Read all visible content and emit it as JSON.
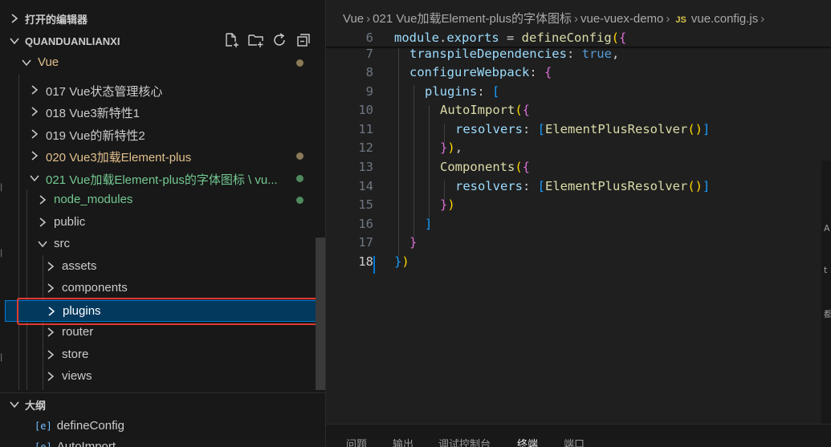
{
  "sidebar": {
    "open_editors_title": "打开的编辑器",
    "project_title": "QUANDUANLIANXI",
    "toolbar": [
      "new-file-icon",
      "new-folder-icon",
      "refresh-icon",
      "collapse-all-icon"
    ],
    "tree": [
      {
        "label": "Vue",
        "color": "#e2c08d",
        "dot": "#8a7a57"
      },
      {
        "label": "017 Vue状态管理核心",
        "color": "#cccccc"
      },
      {
        "label": "018 Vue3新特性1",
        "color": "#cccccc"
      },
      {
        "label": "019 Vue的新特性2",
        "color": "#cccccc"
      },
      {
        "label": "020 Vue3加载Element-plus",
        "color": "#e2c08d",
        "dot": "#8a7a57"
      },
      {
        "label": "021 Vue加载Element-plus的字体图标 \\ vu...",
        "color": "#73c991",
        "dot": "#4f8a5f"
      },
      {
        "label": "node_modules",
        "color": "#73c991",
        "dot": "#4f8a5f"
      },
      {
        "label": "public",
        "color": "#cccccc"
      },
      {
        "label": "src",
        "color": "#cccccc"
      },
      {
        "label": "assets",
        "color": "#cccccc"
      },
      {
        "label": "components",
        "color": "#cccccc"
      },
      {
        "label": "plugins",
        "color": "#ffffff"
      },
      {
        "label": "router",
        "color": "#cccccc"
      },
      {
        "label": "store",
        "color": "#cccccc"
      },
      {
        "label": "views",
        "color": "#cccccc"
      }
    ],
    "outline_title": "大纲",
    "outline_items": [
      {
        "label": "defineConfig",
        "icon": "[e]"
      },
      {
        "label": "AutoImport",
        "icon": "[e]"
      }
    ]
  },
  "breadcrumb": [
    "Vue",
    "021 Vue加载Element-plus的字体图标",
    "vue-vuex-demo",
    "vue.config.js"
  ],
  "breadcrumb_badge": "JS",
  "code": {
    "line_numbers": [
      "6",
      "7",
      "8",
      "9",
      "10",
      "11",
      "12",
      "13",
      "14",
      "15",
      "16",
      "17",
      "18"
    ],
    "active_line": "18"
  },
  "panel_tabs": [
    "问题",
    "输出",
    "调试控制台",
    "终端",
    "端口"
  ],
  "panel_active": "终端",
  "right_strip": [
    "A",
    "t",
    "都"
  ]
}
